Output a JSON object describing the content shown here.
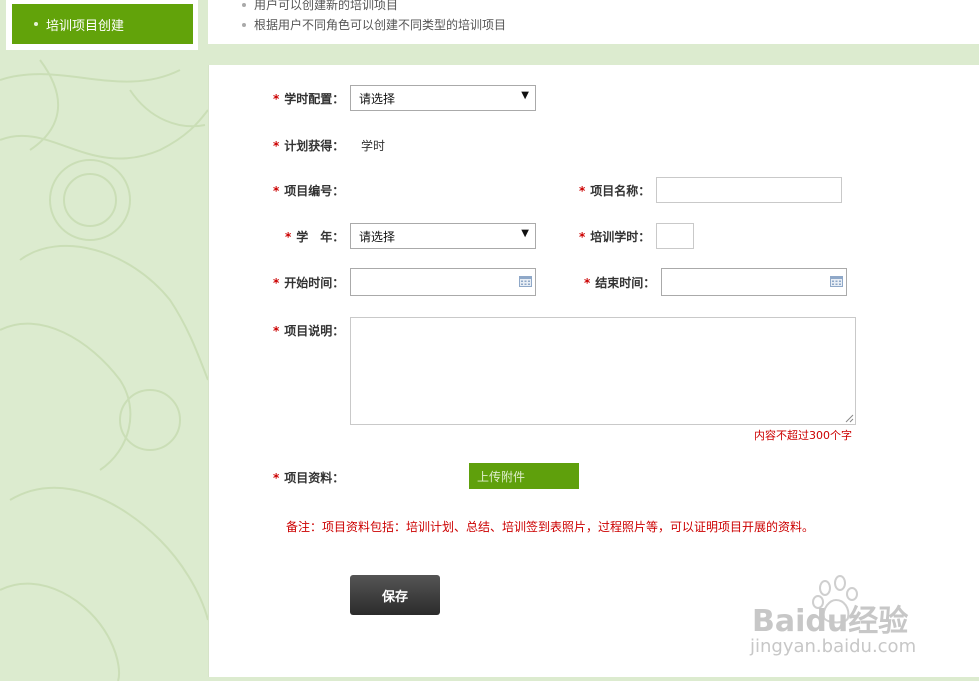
{
  "sidebar": {
    "active_item": "培训项目创建"
  },
  "tips": [
    "用户可以创建新的培训项目",
    "根据用户不同角色可以创建不同类型的培训项目"
  ],
  "form": {
    "hours_config": {
      "label": "学时配置：",
      "value": "请选择"
    },
    "plan_hours": {
      "label": "计划获得：",
      "value": "学时"
    },
    "project_code": {
      "label": "项目编号：",
      "value": ""
    },
    "project_name": {
      "label": "项目名称：",
      "value": ""
    },
    "school_year": {
      "label": "学　年：",
      "value": "请选择"
    },
    "training_hours": {
      "label": "培训学时：",
      "value": ""
    },
    "start_time": {
      "label": "开始时间：",
      "value": ""
    },
    "end_time": {
      "label": "结束时间：",
      "value": ""
    },
    "description": {
      "label": "项目说明：",
      "value": "",
      "hint": "内容不超过300个字"
    },
    "materials": {
      "label": "项目资料：",
      "upload_label": "上传附件"
    },
    "note": "备注：项目资料包括：培训计划、总结、培训签到表照片，过程照片等，可以证明项目开展的资料。",
    "save_label": "保存",
    "required_mark": "*",
    "dropdown_arrow": "▼"
  },
  "watermark": {
    "brand": "Baidu经验",
    "url": "jingyan.baidu.com"
  },
  "colors": {
    "accent": "#62a30a",
    "required": "#cc0000",
    "background": "#dcebcf"
  }
}
